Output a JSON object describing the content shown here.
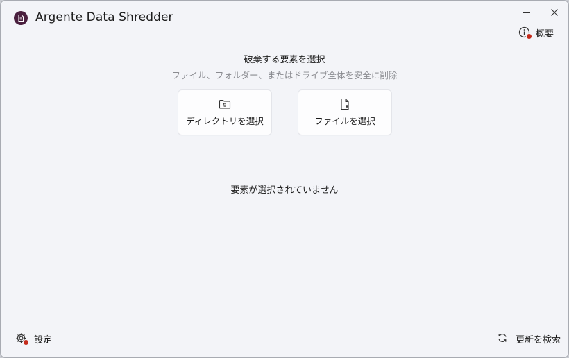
{
  "window": {
    "title": "Argente Data Shredder",
    "minimize_icon": "minimize-icon",
    "close_icon": "close-icon"
  },
  "header": {
    "about_label": "概要",
    "about_icon": "info-icon"
  },
  "main": {
    "heading": "破棄する要素を選択",
    "subheading": "ファイル、フォルダー、またはドライブ全体を安全に削除",
    "select_directory_label": "ディレクトリを選択",
    "select_file_label": "ファイルを選択",
    "empty_status": "要素が選択されていません"
  },
  "footer": {
    "settings_label": "設定",
    "update_label": "更新を検索"
  },
  "colors": {
    "background": "#f3f4f8",
    "card": "#fdfdfe",
    "brand": "#4a1f3e",
    "badge": "#c42b1c",
    "text": "#1b1b1b",
    "muted_text": "#8a8b90"
  }
}
